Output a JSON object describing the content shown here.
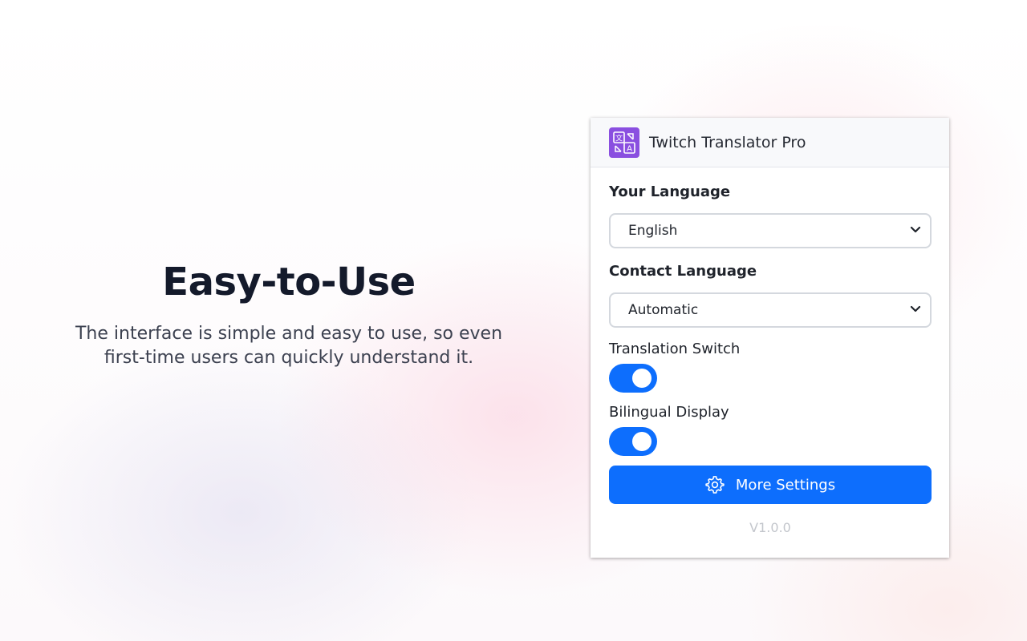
{
  "hero": {
    "title": "Easy-to-Use",
    "subtitle_line1": "The interface is simple and easy to use, so even",
    "subtitle_line2": "first-time users can quickly understand it."
  },
  "panel": {
    "app_title": "Twitch Translator Pro",
    "logo_icon": "translate-icon",
    "your_language": {
      "label": "Your Language",
      "selected": "English"
    },
    "contact_language": {
      "label": "Contact Language",
      "selected": "Automatic"
    },
    "translation_switch": {
      "label": "Translation Switch",
      "on": true
    },
    "bilingual_display": {
      "label": "Bilingual Display",
      "on": true
    },
    "more_settings": {
      "label": "More Settings",
      "icon": "gear-icon"
    },
    "version": "V1.0.0"
  },
  "colors": {
    "accent": "#0d6efd",
    "logo": "#8a4fe0",
    "title_text": "#141a2b"
  }
}
